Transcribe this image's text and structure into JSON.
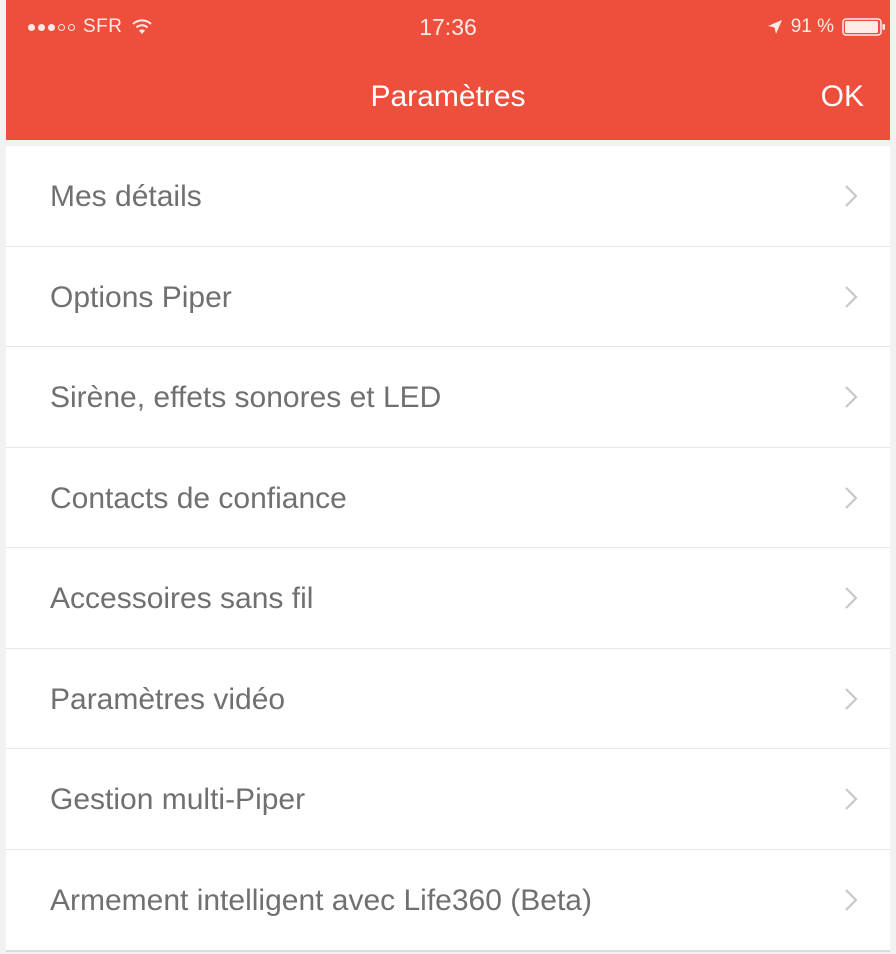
{
  "status_bar": {
    "carrier": "SFR",
    "time": "17:36",
    "battery": "91 %",
    "signal_bars_filled": 3,
    "signal_bars_total": 5
  },
  "nav": {
    "title": "Paramètres",
    "done_label": "OK"
  },
  "colors": {
    "accent": "#ee4e3c",
    "row_text": "#707070",
    "chevron": "#c8c8c8"
  },
  "settings": {
    "items": [
      {
        "label": "Mes détails"
      },
      {
        "label": "Options Piper"
      },
      {
        "label": "Sirène, effets sonores et LED"
      },
      {
        "label": "Contacts de confiance"
      },
      {
        "label": "Accessoires sans fil"
      },
      {
        "label": "Paramètres vidéo"
      },
      {
        "label": "Gestion multi-Piper"
      },
      {
        "label": "Armement intelligent avec Life360 (Beta)"
      }
    ]
  }
}
